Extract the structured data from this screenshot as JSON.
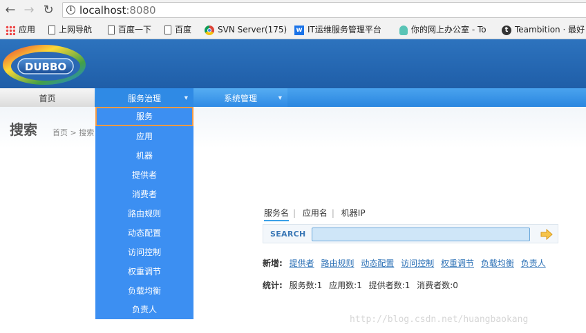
{
  "browser": {
    "url_host": "localhost",
    "url_port": ":8080",
    "bookmarks": [
      {
        "label": "应用",
        "icon": "apps-grid-icon"
      },
      {
        "label": "上网导航",
        "icon": "page-icon"
      },
      {
        "label": "百度一下",
        "icon": "page-icon"
      },
      {
        "label": "百度",
        "icon": "page-icon"
      },
      {
        "label": "SVN Server(175)",
        "icon": "chrome-icon"
      },
      {
        "label": "IT运维服务管理平台",
        "icon": "w-icon"
      },
      {
        "label": "你的网上办公室 - To",
        "icon": "mic-icon"
      },
      {
        "label": "Teambition · 最好",
        "icon": "t-icon"
      }
    ]
  },
  "header": {
    "logo_text": "DUBBO"
  },
  "menu": {
    "home": "首页",
    "service_governance": "服务治理",
    "system_management": "系统管理"
  },
  "dropdown": {
    "items": [
      "服务",
      "应用",
      "机器",
      "提供者",
      "消费者",
      "路由规则",
      "动态配置",
      "访问控制",
      "权重调节",
      "负载均衡",
      "负责人"
    ]
  },
  "page": {
    "title": "搜索",
    "breadcrumb": "首页 > 搜索"
  },
  "search": {
    "tabs": [
      "服务名",
      "应用名",
      "机器IP"
    ],
    "label": "SEARCH",
    "value": ""
  },
  "add_row": {
    "label": "新增:",
    "links": [
      "提供者",
      "路由规则",
      "动态配置",
      "访问控制",
      "权重调节",
      "负载均衡",
      "负责人"
    ]
  },
  "stats_row": {
    "label": "统计:",
    "items": [
      "服务数:1",
      "应用数:1",
      "提供者数:1",
      "消费者数:0"
    ]
  },
  "watermark": "http://blog.csdn.net/huangbaokang",
  "colors": {
    "header_blue": "#2d73be",
    "menu_blue": "#2f8ae5",
    "dropdown_blue": "#3c8ff2",
    "active_outline": "#f39a45",
    "link_blue": "#2a6fb5"
  }
}
